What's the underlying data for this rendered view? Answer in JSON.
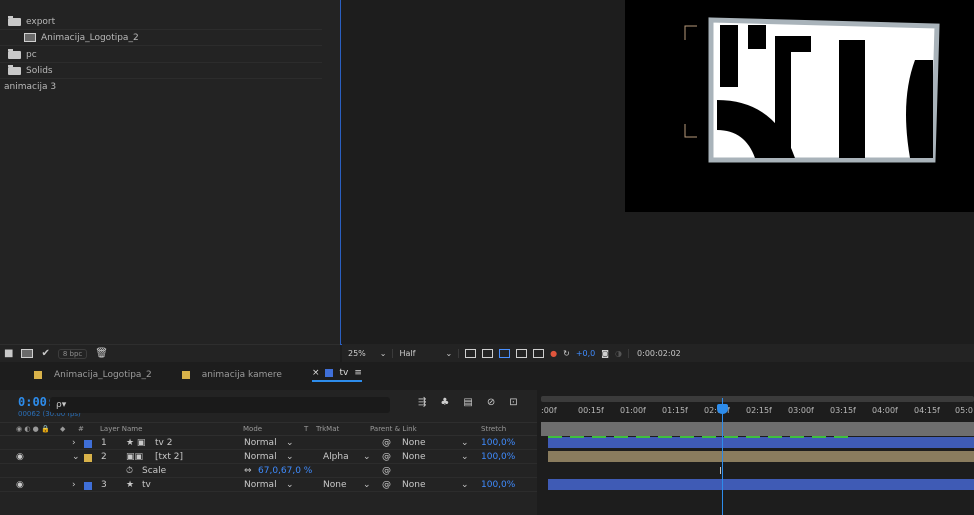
{
  "project": {
    "items": [
      {
        "label": "export",
        "type": "folder"
      },
      {
        "label": "Animacija_Logotipa_2",
        "type": "comp"
      },
      {
        "label": "pc",
        "type": "folder"
      },
      {
        "label": "Solids",
        "type": "folder"
      },
      {
        "label": "animacija 3",
        "type": "text"
      }
    ],
    "bpc": "8 bpc"
  },
  "viewer": {
    "zoom": "25%",
    "resolution": "Half",
    "exposure": "+0,0",
    "timecode": "0:00:02:02"
  },
  "timeline": {
    "tabs": [
      {
        "label": "Animacija_Logotipa_2",
        "color": "#d8b24a",
        "active": false
      },
      {
        "label": "animacija kamere",
        "color": "#d8b24a",
        "active": false
      },
      {
        "label": "tv",
        "color": "#3f6fd8",
        "active": true
      }
    ],
    "close_glyph": "×",
    "menu_glyph": "≡",
    "current_time": "0:00:02:02",
    "frame_info": "00062 (30.00 fps)",
    "search_placeholder": "ρ▾",
    "columns": {
      "number": "#",
      "layer_name": "Layer Name",
      "mode": "Mode",
      "t": "T",
      "trkmat": "TrkMat",
      "parent": "Parent & Link",
      "stretch": "Stretch"
    },
    "layers": [
      {
        "num": "1",
        "name": "tv 2",
        "mode": "Normal",
        "trkmat": "",
        "parent": "None",
        "stretch": "100,0%",
        "color": "#3f6fd8"
      },
      {
        "num": "2",
        "name": "[txt 2]",
        "mode": "Normal",
        "trkmat": "Alpha",
        "parent": "None",
        "stretch": "100,0%",
        "color": "#d8b24a"
      },
      {
        "num": "",
        "name": "Scale",
        "mode": "67,0,67,0 %",
        "trkmat": "",
        "parent": "",
        "stretch": "",
        "color": ""
      },
      {
        "num": "3",
        "name": "tv",
        "mode": "Normal",
        "trkmat": "None",
        "parent": "None",
        "stretch": "100,0%",
        "color": "#3f6fd8"
      }
    ],
    "ruler_ticks": [
      ":00f",
      "00:15f",
      "01:00f",
      "01:15f",
      "02:00f",
      "02:15f",
      "03:00f",
      "03:15f",
      "04:00f",
      "04:15f",
      "05:0"
    ]
  }
}
